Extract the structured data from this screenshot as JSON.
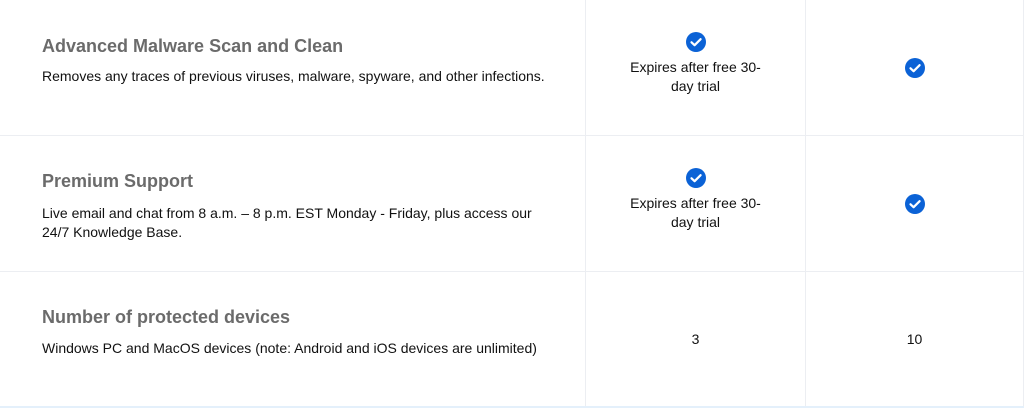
{
  "accent_color": "#0b62d6",
  "rows": [
    {
      "title": "Advanced Malware Scan and Clean",
      "description": "Removes any traces of previous viruses, malware, spyware, and other infections.",
      "plan_a": {
        "icon": "check-circle-icon",
        "note": "Expires after free 30-day trial"
      },
      "plan_b": {
        "icon": "check-circle-icon"
      }
    },
    {
      "title": "Premium Support",
      "description": "Live email and chat from 8 a.m. – 8 p.m. EST Monday - Friday, plus access our 24/7 Knowledge Base.",
      "plan_a": {
        "icon": "check-circle-icon",
        "note": "Expires after free 30-day trial"
      },
      "plan_b": {
        "icon": "check-circle-icon"
      }
    },
    {
      "title": "Number of protected devices",
      "description": "Windows PC and MacOS devices (note: Android and iOS devices are unlimited)",
      "plan_a": {
        "value": "3"
      },
      "plan_b": {
        "value": "10"
      }
    }
  ]
}
